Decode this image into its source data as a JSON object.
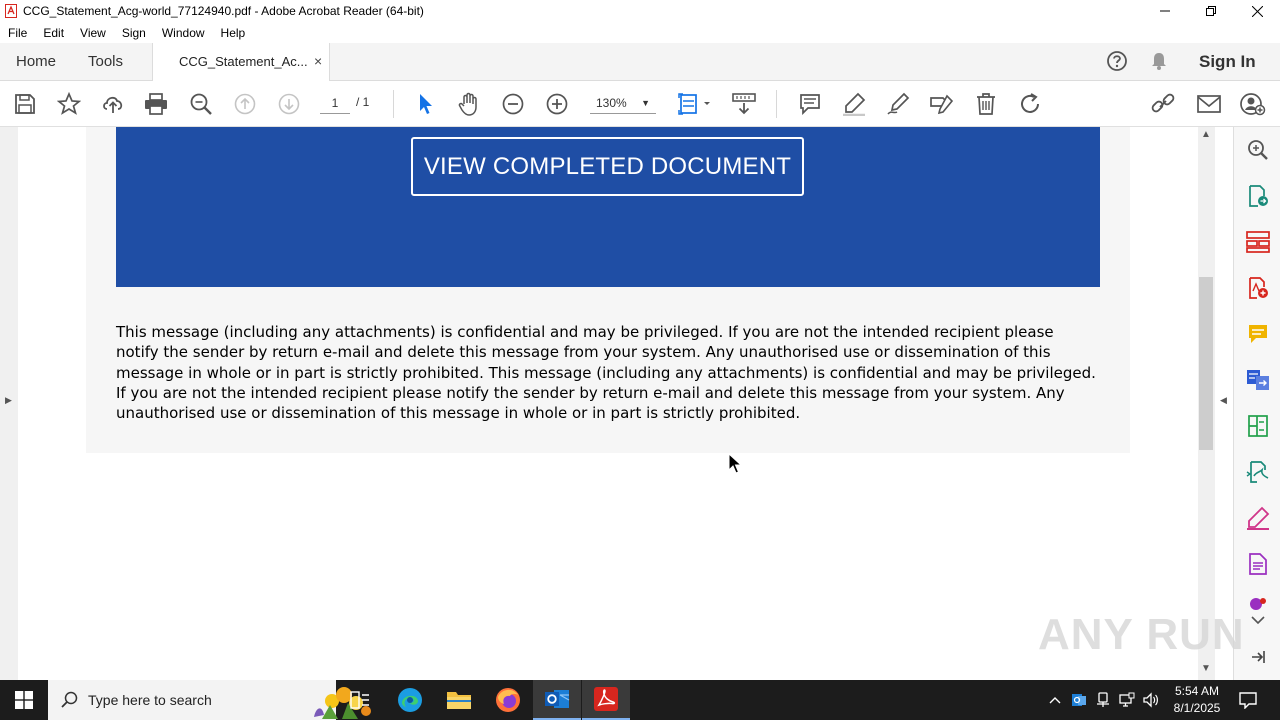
{
  "window": {
    "title": "CCG_Statement_Acg-world_77124940.pdf - Adobe Acrobat Reader (64-bit)"
  },
  "menu": [
    "File",
    "Edit",
    "View",
    "Sign",
    "Window",
    "Help"
  ],
  "tabs": {
    "home": "Home",
    "tools": "Tools",
    "document": "CCG_Statement_Ac...",
    "close_glyph": "×"
  },
  "header": {
    "sign_in": "Sign In"
  },
  "toolbar": {
    "current_page": "1",
    "total_pages": "/ 1",
    "zoom": "130%"
  },
  "document": {
    "button_label": "VIEW COMPLETED DOCUMENT",
    "disclaimer": "This message (including any attachments) is confidential and may be privileged. If you are not the intended recipient please notify the sender by return e-mail and delete this message from your system. Any unauthorised use or dissemination of this message in whole or in part is strictly prohibited. This message (including any attachments) is confidential and may be privileged. If you are not the intended recipient please notify the sender by return e-mail and delete this message from your system. Any unauthorised use or dissemination of this message in whole or in part is strictly prohibited.",
    "banner_color": "#1f4ea5"
  },
  "watermark": "ANY RUN",
  "taskbar": {
    "search_placeholder": "Type here to search",
    "time": "5:54 AM",
    "date": "8/1/2025"
  },
  "colors": {
    "acrobat_red": "#d7261e",
    "accent_blue": "#1473e6"
  }
}
